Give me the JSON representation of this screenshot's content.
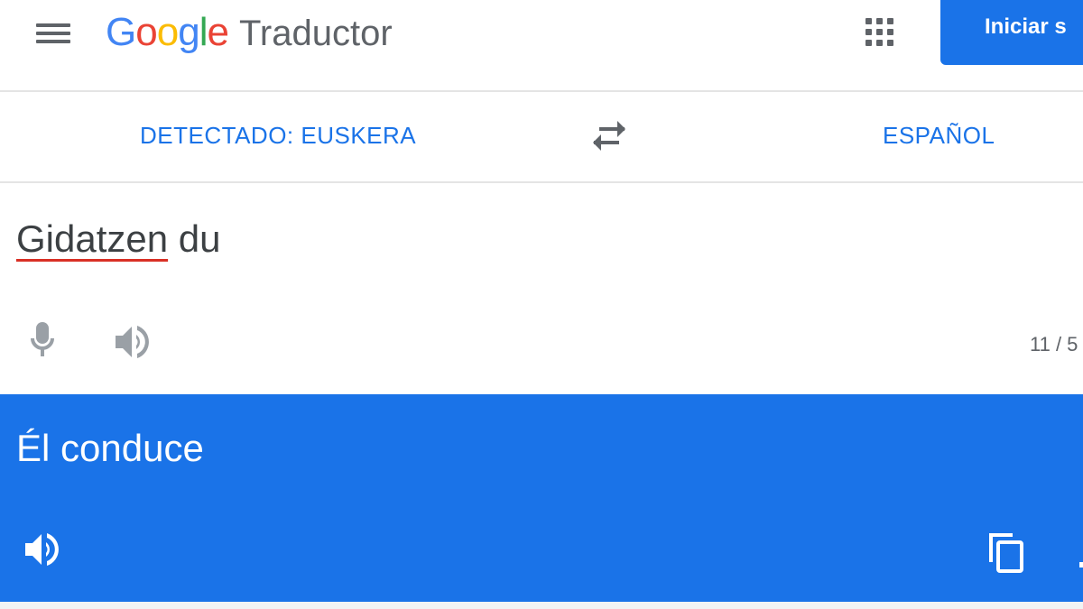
{
  "header": {
    "menu_icon": "hamburger-menu-icon",
    "logo_letters": [
      {
        "char": "G",
        "color": "#4285f4"
      },
      {
        "char": "o",
        "color": "#ea4335"
      },
      {
        "char": "o",
        "color": "#fbbc05"
      },
      {
        "char": "g",
        "color": "#4285f4"
      },
      {
        "char": "l",
        "color": "#34a853"
      },
      {
        "char": "e",
        "color": "#ea4335"
      }
    ],
    "product_name": "Traductor",
    "apps_icon": "apps-grid-icon",
    "signin_label": "Iniciar s"
  },
  "languages": {
    "source": "DETECTADO: EUSKERA",
    "swap_icon": "swap-arrows-icon",
    "target": "ESPAÑOL"
  },
  "source": {
    "text_misspelled": "Gidatzen",
    "text_rest": " du",
    "mic_icon": "microphone-icon",
    "speaker_icon": "speaker-icon",
    "char_count": "11 / 5"
  },
  "result": {
    "text": "Él conduce",
    "speaker_icon": "speaker-icon",
    "copy_icon": "copy-icon"
  },
  "colors": {
    "accent": "#1a73e8",
    "icon_gray": "#5f6368",
    "icon_light_gray": "#9aa0a6",
    "spell_underline": "#d93025"
  }
}
